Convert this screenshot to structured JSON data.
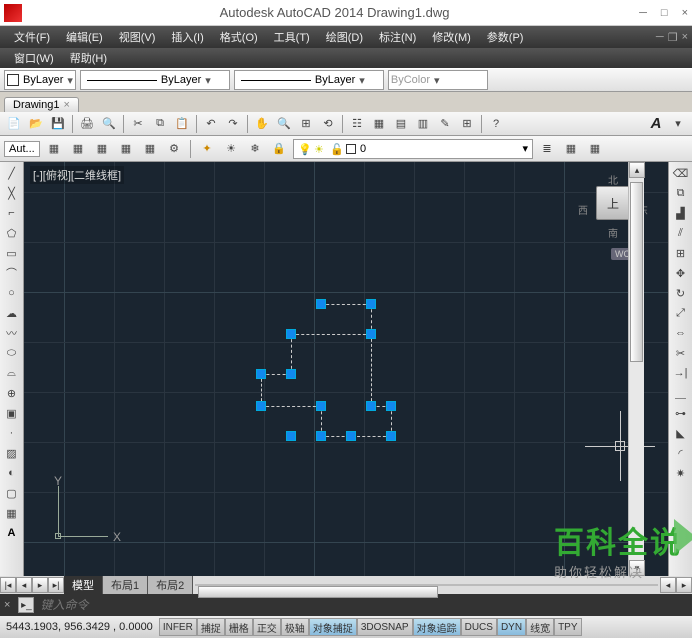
{
  "title": "Autodesk AutoCAD 2014     Drawing1.dwg",
  "menu1": [
    "文件(F)",
    "编辑(E)",
    "视图(V)",
    "插入(I)",
    "格式(O)",
    "工具(T)",
    "绘图(D)",
    "标注(N)",
    "修改(M)",
    "参数(P)"
  ],
  "menu2": [
    "窗口(W)",
    "帮助(H)"
  ],
  "prop": {
    "color": "ByLayer",
    "ltype": "ByLayer",
    "lweight": "ByLayer",
    "bycolor": "ByColor"
  },
  "filetab": "Drawing1",
  "aut_label": "Aut...",
  "layer": {
    "name": "0"
  },
  "canvas_label": "[-][俯视][二维线框]",
  "viewcube": {
    "top": "上",
    "n": "北",
    "s": "南",
    "e": "东",
    "w": "西",
    "wcs": "WCS"
  },
  "ucs": {
    "x": "X",
    "y": "Y"
  },
  "tabs": {
    "model": "模型",
    "l1": "布局1",
    "l2": "布局2"
  },
  "cmd_placeholder": "键入命令",
  "coords": "5443.1903, 956.3429 , 0.0000",
  "status_btns": [
    "INFER",
    "捕捉",
    "栅格",
    "正交",
    "极轴",
    "对象捕捉",
    "3DOSNAP",
    "对象追踪",
    "DUCS",
    "DYN",
    "线宽",
    "TPY"
  ],
  "watermark": {
    "big": "百科全说",
    "small": "助你轻松解决"
  }
}
